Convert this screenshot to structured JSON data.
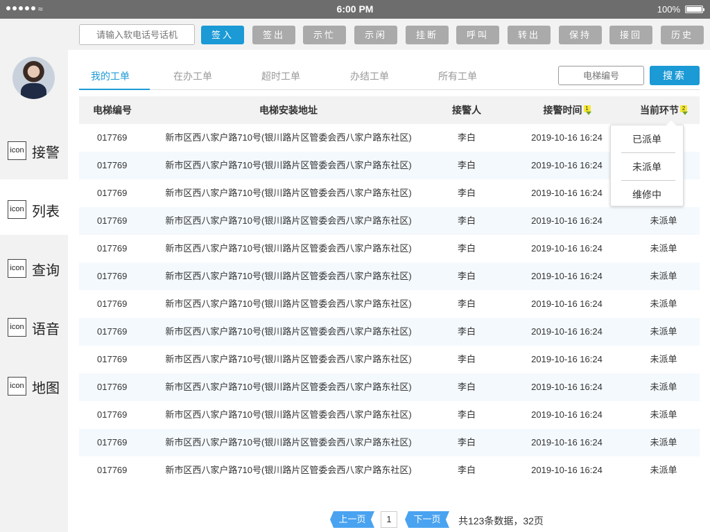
{
  "status_bar": {
    "time": "6:00 PM",
    "battery": "100%"
  },
  "toolbar": {
    "phone_placeholder": "请输入软电话号话机",
    "buttons": [
      "签入",
      "签出",
      "示忙",
      "示闲",
      "挂断",
      "呼叫",
      "转出",
      "保持",
      "接回",
      "历史"
    ],
    "active_button": "签入"
  },
  "sidebar": {
    "items": [
      {
        "icon": "icon",
        "label": "接警"
      },
      {
        "icon": "icon",
        "label": "列表"
      },
      {
        "icon": "icon",
        "label": "查询"
      },
      {
        "icon": "icon",
        "label": "语音"
      },
      {
        "icon": "icon",
        "label": "地图"
      }
    ],
    "selected": "列表"
  },
  "tabs": [
    "我的工单",
    "在办工单",
    "超时工单",
    "办结工单",
    "所有工单"
  ],
  "active_tab": "我的工单",
  "search": {
    "placeholder": "电梯编号",
    "button": "搜索"
  },
  "table": {
    "columns": [
      "电梯编号",
      "电梯安装地址",
      "接警人",
      "接警时间",
      "当前环节"
    ],
    "sort_badges": {
      "time": "1",
      "stage": "2"
    },
    "rows": [
      [
        "017769",
        "新市区西八家户路710号(银川路片区管委会西八家户路东社区)",
        "李白",
        "2019-10-16 16:24",
        ""
      ],
      [
        "017769",
        "新市区西八家户路710号(银川路片区管委会西八家户路东社区)",
        "李白",
        "2019-10-16 16:24",
        ""
      ],
      [
        "017769",
        "新市区西八家户路710号(银川路片区管委会西八家户路东社区)",
        "李白",
        "2019-10-16 16:24",
        ""
      ],
      [
        "017769",
        "新市区西八家户路710号(银川路片区管委会西八家户路东社区)",
        "李白",
        "2019-10-16 16:24",
        "未派单"
      ],
      [
        "017769",
        "新市区西八家户路710号(银川路片区管委会西八家户路东社区)",
        "李白",
        "2019-10-16 16:24",
        "未派单"
      ],
      [
        "017769",
        "新市区西八家户路710号(银川路片区管委会西八家户路东社区)",
        "李白",
        "2019-10-16 16:24",
        "未派单"
      ],
      [
        "017769",
        "新市区西八家户路710号(银川路片区管委会西八家户路东社区)",
        "李白",
        "2019-10-16 16:24",
        "未派单"
      ],
      [
        "017769",
        "新市区西八家户路710号(银川路片区管委会西八家户路东社区)",
        "李白",
        "2019-10-16 16:24",
        "未派单"
      ],
      [
        "017769",
        "新市区西八家户路710号(银川路片区管委会西八家户路东社区)",
        "李白",
        "2019-10-16 16:24",
        "未派单"
      ],
      [
        "017769",
        "新市区西八家户路710号(银川路片区管委会西八家户路东社区)",
        "李白",
        "2019-10-16 16:24",
        "未派单"
      ],
      [
        "017769",
        "新市区西八家户路710号(银川路片区管委会西八家户路东社区)",
        "李白",
        "2019-10-16 16:24",
        "未派单"
      ],
      [
        "017769",
        "新市区西八家户路710号(银川路片区管委会西八家户路东社区)",
        "李白",
        "2019-10-16 16:24",
        "未派单"
      ],
      [
        "017769",
        "新市区西八家户路710号(银川路片区管委会西八家户路东社区)",
        "李白",
        "2019-10-16 16:24",
        "未派单"
      ]
    ]
  },
  "dropdown": {
    "options": [
      "已派单",
      "未派单",
      "维修中"
    ]
  },
  "pagination": {
    "prev": "上一页",
    "current": "1",
    "next": "下一页",
    "info": "共123条数据，32页"
  },
  "colors": {
    "accent": "#1b9ad6",
    "button_gray": "#aaaaaa",
    "row_alt": "#f4f9fd"
  }
}
